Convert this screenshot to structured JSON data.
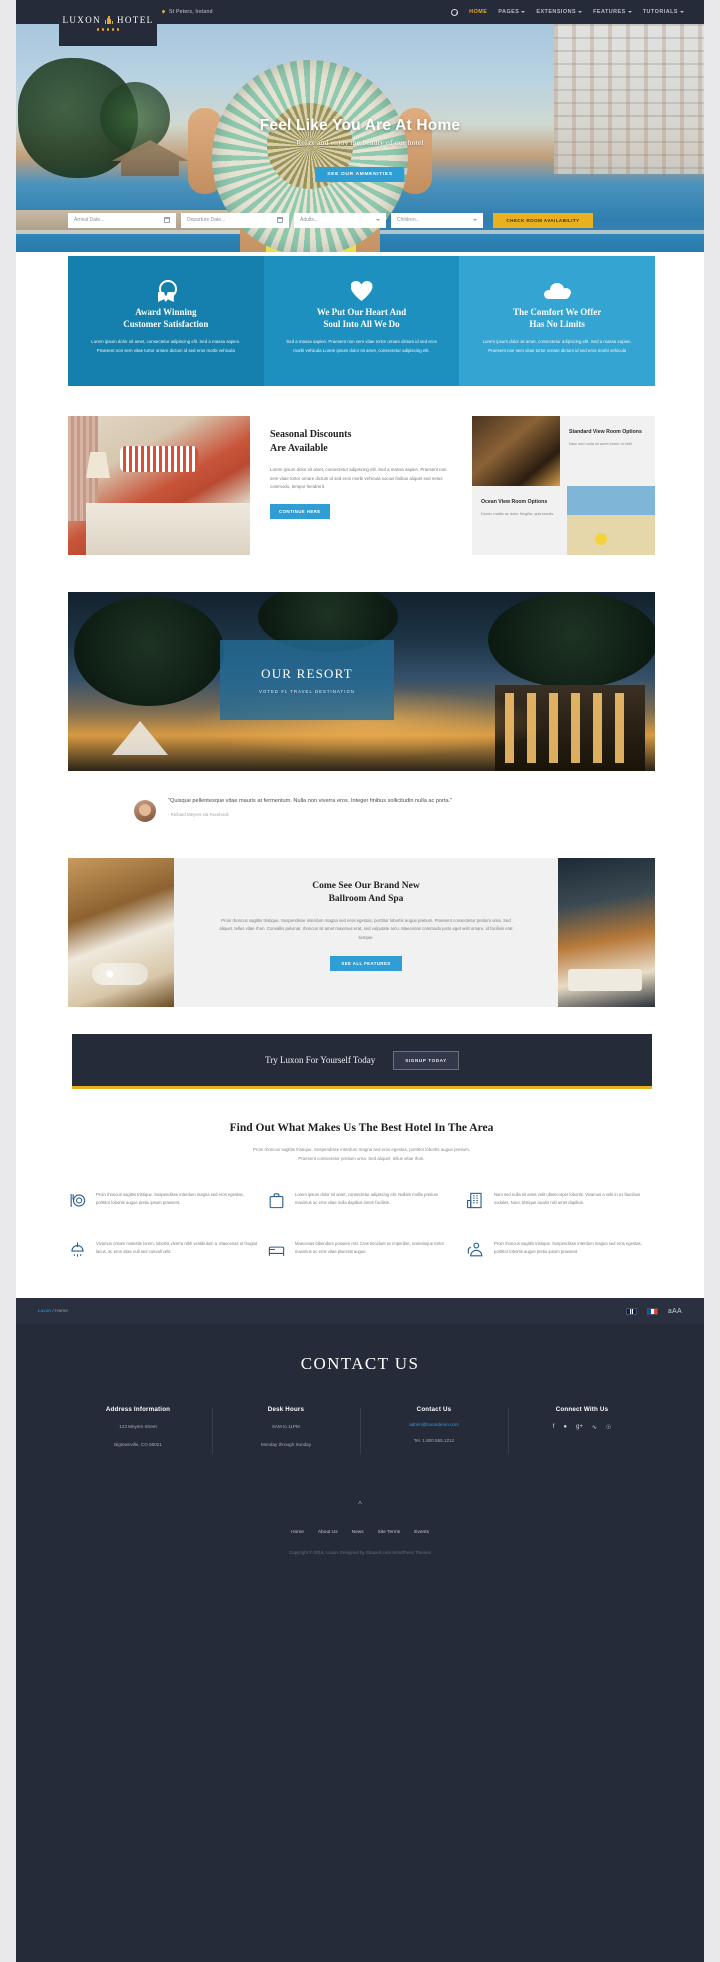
{
  "topbar": {
    "location": "St Peters, Ireland",
    "search_icon": "search-icon",
    "menu": [
      {
        "label": "HOME",
        "active": true,
        "caret": false
      },
      {
        "label": "PAGES",
        "active": false,
        "caret": true
      },
      {
        "label": "EXTENSIONS",
        "active": false,
        "caret": true
      },
      {
        "label": "FEATURES",
        "active": false,
        "caret": true
      },
      {
        "label": "TUTORIALS",
        "active": false,
        "caret": true
      }
    ]
  },
  "logo": {
    "name": "LUXON",
    "name2": "HOTEL",
    "icon": "building-icon",
    "stars": 5
  },
  "hero": {
    "title": "Feel Like You Are At Home",
    "subtitle": "Relax and enjoy the beauty of our hotel",
    "cta": "SEE OUR AMMENITIES"
  },
  "booking": {
    "arrival_placeholder": "Arrival Date...",
    "departure_placeholder": "Departure Date...",
    "adults_placeholder": "Adults...",
    "children_placeholder": "Children...",
    "submit": "CHECK ROOM AVAILABILITY",
    "submit_color": "#e8b11d"
  },
  "features_trio": [
    {
      "icon": "award-ribbon-icon",
      "title": "Award Winning\nCustomer Satisfaction",
      "title_l1": "Award Winning",
      "title_l2": "Customer Satisfaction",
      "body": "Lorem ipsum dolor sit amet, consectetur adipiscing elit. Sed a massa sapien. Praesent non sem vitae tortor ornare dictum id sed eros morbi vehicula",
      "color": "#1580ad"
    },
    {
      "icon": "heart-icon",
      "title_l1": "We Put Our Heart And",
      "title_l2": "Soul Into All We Do",
      "body": "Sed a massa sapien. Praesent non sem vitae tortor ornare dictum id sed eros morbi vehicula Lorem ipsum dolor sit amet, consectetur adipiscing elit.",
      "color": "#1e90c0"
    },
    {
      "icon": "cloud-icon",
      "title_l1": "The Comfort We Offer",
      "title_l2": "Has No Limits",
      "body": "Lorem ipsum dolor sit amet, consectetur adipiscing elit. Sed a massa sapien. Praesent non sem vitae tortor ornare dictum id sed eros morbi vehicula",
      "color": "#34a4d2"
    }
  ],
  "seasonal": {
    "image": "hotel-room-bed-image",
    "title_l1": "Seasonal Discounts",
    "title_l2": "Are Available",
    "body": "Lorem ipsum dolor sit amet, consectetur adipiscing elit. Sed a massa sapien. Praesent non sem vitae tortor ornare dictum id sed eros morbi vehicula socius finibus aliquet sed netus commodo, tempor hendrerit.",
    "button": "CONTINUE HERE",
    "rooms": [
      {
        "title": "Standard View\nRoom Options",
        "title_text": "Standard View Room Options",
        "body": "Nam sed nulla sit amet lorem ut velit.",
        "image": "spa-mortar-candle-image"
      },
      {
        "title_text": "Ocean View Room Options",
        "body": "Donec mattis ac dolor fringilla, quis iaculis.",
        "image": "beach-children-image"
      }
    ]
  },
  "resort": {
    "image": "resort-night-exterior-image",
    "title": "OUR RESORT",
    "subtitle": "VOTED #1 TRAVEL DESTINATION"
  },
  "testimonial": {
    "avatar": "reviewer-avatar",
    "quote": "\"Quisque pellentesque vitae mauris at fermentum. Nulla non viverra eros. Integer finibus sollicitudin nulla ac porta.\"",
    "attribution": "- Richard Meyers via Facebook"
  },
  "ballroom": {
    "left_image": "spa-towels-image",
    "right_image": "restaurant-interior-image",
    "title_l1": "Come See Our Brand New",
    "title_l2": "Ballroom And Spa",
    "body": "Proin rhoncus sagittis tristique. Suspendisse interdum magna sed eros egestas, porttitor lobortis augue pretium. Praesent consectetur pretium urna. Sed aliquet, tellus vitae rhon. Convallis pulvinar, rhoncus sit amet maximus erat, sed vulputate arcu. Maecenas commodo justo eget velit ornare, id facilisis erat semper.",
    "button": "SEE ALL FEATURES"
  },
  "cta_strip": {
    "text": "Try Luxon For Yourself Today",
    "button": "SIGNUP TODAY",
    "rule_color": "#e8b11d"
  },
  "features_section": {
    "heading": "Find Out What Makes Us The Best Hotel In The Area",
    "subtext_l1": "Proin rhoncus sagittis tristique. Suspendisse interdum magna sed eros egestas, porttitor lobortis augue pretium.",
    "subtext_l2": "Praesent consectetur pretium urna. Sed aliquet, tellus vitae rhon.",
    "items": [
      {
        "icon": "dining-plate-icon",
        "text": "Proin rhoncus sagittis tristique. Suspendisse interdum magna sed eros egestas, porttitor lobortis augue pretiu ipsum praesent."
      },
      {
        "icon": "briefcase-icon",
        "text": "Lorem ipsum dolor sit amet, consectetur adipiscing elit. Nullam mollis pretium maximus ac eros vitae nulla dapibus lorem facilisis."
      },
      {
        "icon": "building-icon",
        "text": "Nam sed nulla sit amet velit ullamcorper lobortis. Vivamus a velit in ex faucibus sodales. Nunc tristique iaculis nisl amet dapibus."
      },
      {
        "icon": "shower-icon",
        "text": "Vivamus ornare molestie lorem, lobortis viverra nibh vestibulum a. Maecenas ut feugiat lacus, ac eros vitae null sed convall velit."
      },
      {
        "icon": "bed-icon",
        "text": "Maecenas bibendum posuere nisl. Cras tincidunt ex imperdiet, scelerisque tortor maximus ac eros vitae placerat augue."
      },
      {
        "icon": "concierge-icon",
        "text": "Proin rhoncus sagittis tristique. Suspendisse interdum magna sed eros egestas, porttitor lobortis augue pretiu ipsum praesent."
      }
    ]
  },
  "footer": {
    "breadcrumb_home": "Luxon",
    "breadcrumb_sep": "/",
    "breadcrumb_current": "Home",
    "flags": [
      "uk-flag-icon",
      "fr-flag-icon"
    ],
    "font_size_control": "aAA",
    "heading": "CONTACT US",
    "columns": [
      {
        "title": "Address Information",
        "line1": "123 Meyers Street",
        "line2": "Bigtownville, CO 56021"
      },
      {
        "title": "Desk Hours",
        "line1": "6AM to 11PM",
        "line2": "Monday through Sunday"
      },
      {
        "title": "Contact Us",
        "email": "admin@luxondemo.com",
        "line2": "Tel. 1.800.555.1212"
      },
      {
        "title": "Connect With Us",
        "socials": [
          "facebook-icon",
          "twitter-icon",
          "google-plus-icon",
          "rss-icon",
          "pinterest-icon"
        ]
      }
    ],
    "scroll_top_icon": "chevron-up-icon",
    "links": [
      "Home",
      "About Us",
      "News",
      "Site Terms",
      "Events"
    ],
    "copyright": "Copyright © 2016, Luxon. Designed by ShapeS.com WordPress Themes"
  }
}
